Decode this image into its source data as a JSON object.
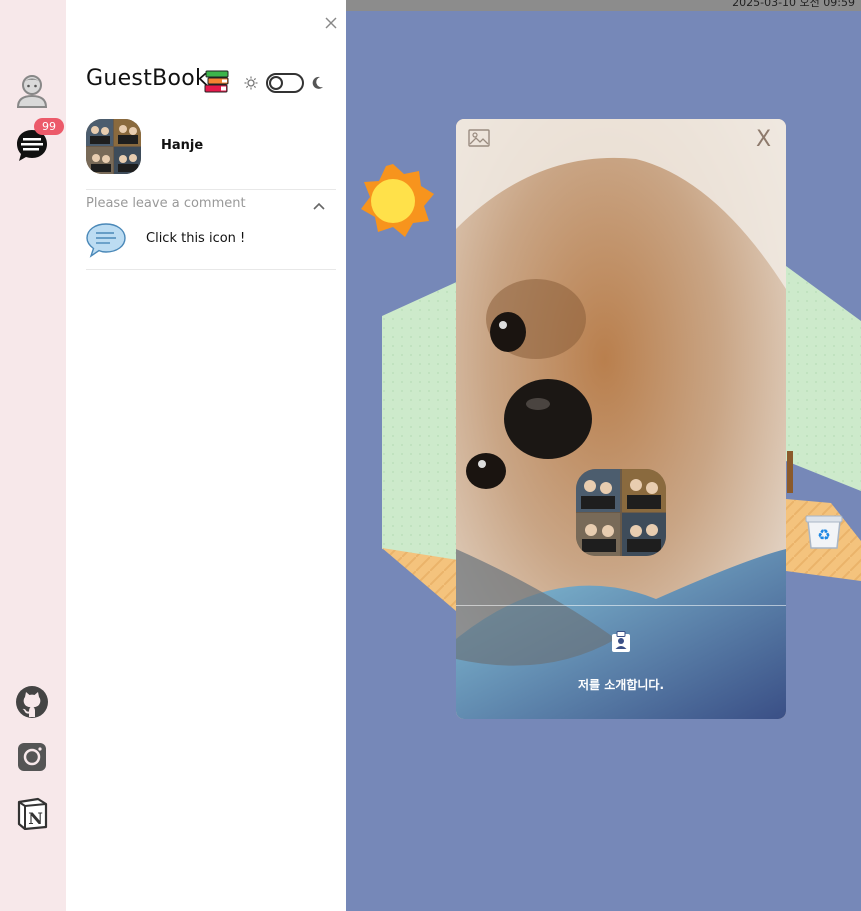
{
  "status": {
    "datetime": "2025-03-10 오전 09:59"
  },
  "rail": {
    "notification_count": "99"
  },
  "guestbook": {
    "title": "GuestBook",
    "profile_name": "Hanje",
    "comment_placeholder": "Please leave a comment",
    "comment_hint": "Click this icon !"
  },
  "modal": {
    "close_label": "X",
    "intro_text": "저를 소개합니다."
  },
  "colors": {
    "rail_bg": "#f7e8ea",
    "room_bg": "#7688b8",
    "badge": "#ec5a6a",
    "wall": "#cdeacb",
    "floor": "#f4c37d",
    "sun": "#ffd740"
  },
  "icons": [
    "user-icon",
    "chat-icon",
    "github-icon",
    "instagram-icon",
    "notion-icon",
    "close-icon",
    "books-icon",
    "sun-icon",
    "moon-icon",
    "chevron-up-icon",
    "comment-bubble-icon",
    "image-icon",
    "recycle-bin-icon",
    "contact-badge-icon"
  ]
}
